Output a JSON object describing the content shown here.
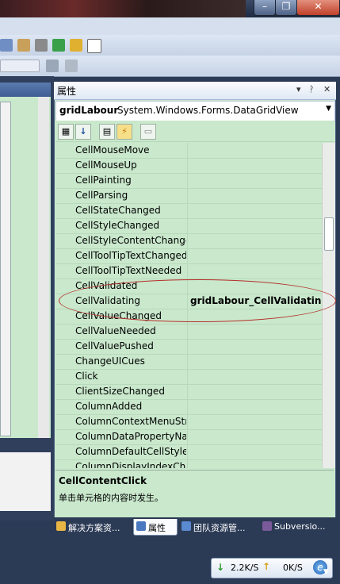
{
  "window": {
    "minimize_glyph": "–",
    "maximize_glyph": "❐",
    "close_glyph": "✕"
  },
  "properties_panel": {
    "title": "属性",
    "pin_glyph": "▾",
    "autohide_glyph": "ᚹ",
    "close_glyph": "✕",
    "object_name": "gridLabour",
    "object_type": "System.Windows.Forms.DataGridView",
    "dropdown_glyph": "▼",
    "toolbar": {
      "categorized_glyph": "▦",
      "alphabetical_glyph": "↓",
      "properties_glyph": "▤",
      "events_glyph": "⚡",
      "pages_glyph": "▭"
    },
    "rows": [
      {
        "name": "CellMouseMove",
        "value": ""
      },
      {
        "name": "CellMouseUp",
        "value": ""
      },
      {
        "name": "CellPainting",
        "value": ""
      },
      {
        "name": "CellParsing",
        "value": ""
      },
      {
        "name": "CellStateChanged",
        "value": ""
      },
      {
        "name": "CellStyleChanged",
        "value": ""
      },
      {
        "name": "CellStyleContentChanged",
        "value": ""
      },
      {
        "name": "CellToolTipTextChanged",
        "value": ""
      },
      {
        "name": "CellToolTipTextNeeded",
        "value": ""
      },
      {
        "name": "CellValidated",
        "value": ""
      },
      {
        "name": "CellValidating",
        "value": "gridLabour_CellValidating"
      },
      {
        "name": "CellValueChanged",
        "value": ""
      },
      {
        "name": "CellValueNeeded",
        "value": ""
      },
      {
        "name": "CellValuePushed",
        "value": ""
      },
      {
        "name": "ChangeUICues",
        "value": ""
      },
      {
        "name": "Click",
        "value": ""
      },
      {
        "name": "ClientSizeChanged",
        "value": ""
      },
      {
        "name": "ColumnAdded",
        "value": ""
      },
      {
        "name": "ColumnContextMenuStripChanged",
        "value": ""
      },
      {
        "name": "ColumnDataPropertyNameChanged",
        "value": ""
      },
      {
        "name": "ColumnDefaultCellStyleChanged",
        "value": ""
      },
      {
        "name": "ColumnDisplayIndexChanged",
        "value": ""
      }
    ],
    "description_title": "CellContentClick",
    "description_text": "单击单元格的内容时发生。"
  },
  "tabs": [
    {
      "label": "解决方案资...",
      "active": false,
      "icon_color": "#e6b544"
    },
    {
      "label": "属性",
      "active": true,
      "icon_color": "#4a78c0"
    },
    {
      "label": "团队资源管...",
      "active": false,
      "icon_color": "#5a8ad0"
    },
    {
      "label": "Subversio...",
      "active": false,
      "icon_color": "#7a5a9a"
    }
  ],
  "status": {
    "download_speed": "2.2K/S",
    "upload_speed": "0K/S",
    "download_glyph": "↓",
    "upload_glyph": "↑",
    "ie_glyph": "e",
    "expand_glyph": "▼"
  },
  "colors": {
    "panel_bg": "#c9e8cc",
    "highlight_ellipse": "#b5302a"
  }
}
